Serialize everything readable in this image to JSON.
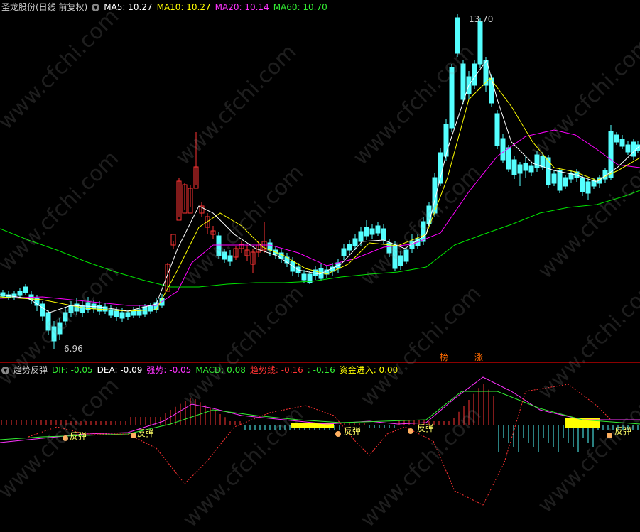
{
  "header": {
    "stock": "圣龙股份(日线 前复权)",
    "ma5": "MA5: 10.27",
    "ma10": "MA10: 10.27",
    "ma20": "MA20: 10.14",
    "ma60": "MA60: 10.70"
  },
  "main": {
    "high_label": "13.70",
    "low_label": "6.96",
    "badge1": "榜",
    "badge2": "涨"
  },
  "indicator": {
    "name": "趋势反弹",
    "dif": "DIF: -0.05",
    "dea": "DEA: -0.09",
    "strength": "强势: -0.05",
    "macd": "MACD: 0.08",
    "trend": "趋势线: -0.16",
    "trend2": ": -0.16",
    "fund": "资金进入: 0.00",
    "signal_label": "反弹"
  },
  "watermark": "www.cfchi.com",
  "colors": {
    "up": "#ff3333",
    "down": "#54ffff",
    "ma5": "#ffffff",
    "ma10": "#ffff00",
    "ma20": "#ff00ff",
    "ma60": "#00e600"
  }
}
